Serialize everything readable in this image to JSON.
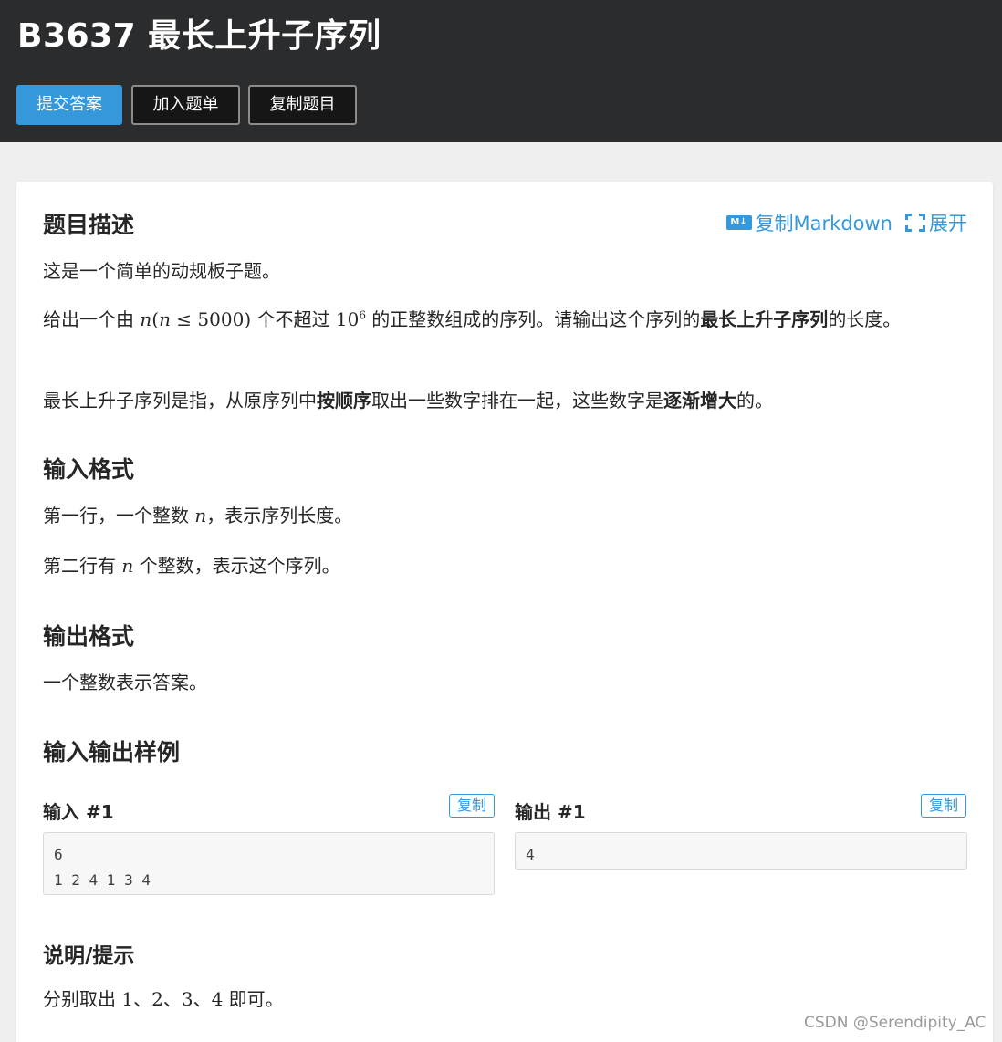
{
  "header": {
    "title": "B3637 最长上升子序列",
    "buttons": {
      "submit": "提交答案",
      "add_to_list": "加入题单",
      "copy_problem": "复制题目"
    }
  },
  "toolbar": {
    "copy_markdown": "复制Markdown",
    "expand": "展开",
    "md_icon_text": "M↓"
  },
  "description": {
    "heading": "题目描述",
    "p1": "这是一个简单的动规板子题。",
    "p2": {
      "t1": "给出一个由 ",
      "m1": "n",
      "m2": "(",
      "m3": "n",
      "m4": " ≤ 5000)",
      "t2": " 个不超过 ",
      "m5": "10",
      "sup": "6",
      "t3": " 的正整数组成的序列。请输出这个序列的",
      "b1": "最长上升子序列",
      "t4": "的长度。"
    },
    "p3": {
      "t1": "最长上升子序列是指，从原序列中",
      "b1": "按顺序",
      "t2": "取出一些数字排在一起，这些数字是",
      "b2": "逐渐增大",
      "t3": "的。"
    }
  },
  "input_format": {
    "heading": "输入格式",
    "p1": {
      "t1": "第一行，一个整数 ",
      "m1": "n",
      "t2": "，表示序列长度。"
    },
    "p2": {
      "t1": "第二行有 ",
      "m1": "n",
      "t2": " 个整数，表示这个序列。"
    }
  },
  "output_format": {
    "heading": "输出格式",
    "p1": "一个整数表示答案。"
  },
  "samples": {
    "heading": "输入输出样例",
    "input_label": "输入 #1",
    "output_label": "输出 #1",
    "copy_label": "复制",
    "input_text": "6\n1 2 4 1 3 4",
    "output_text": "4"
  },
  "hint": {
    "heading": "说明/提示",
    "p1": {
      "t1": "分别取出 ",
      "m1": "1",
      "t2": "、",
      "m2": "2",
      "t3": "、",
      "m3": "3",
      "t4": "、",
      "m4": "4",
      "t5": " 即可。"
    }
  },
  "watermark": "CSDN @Serendipity_AC"
}
